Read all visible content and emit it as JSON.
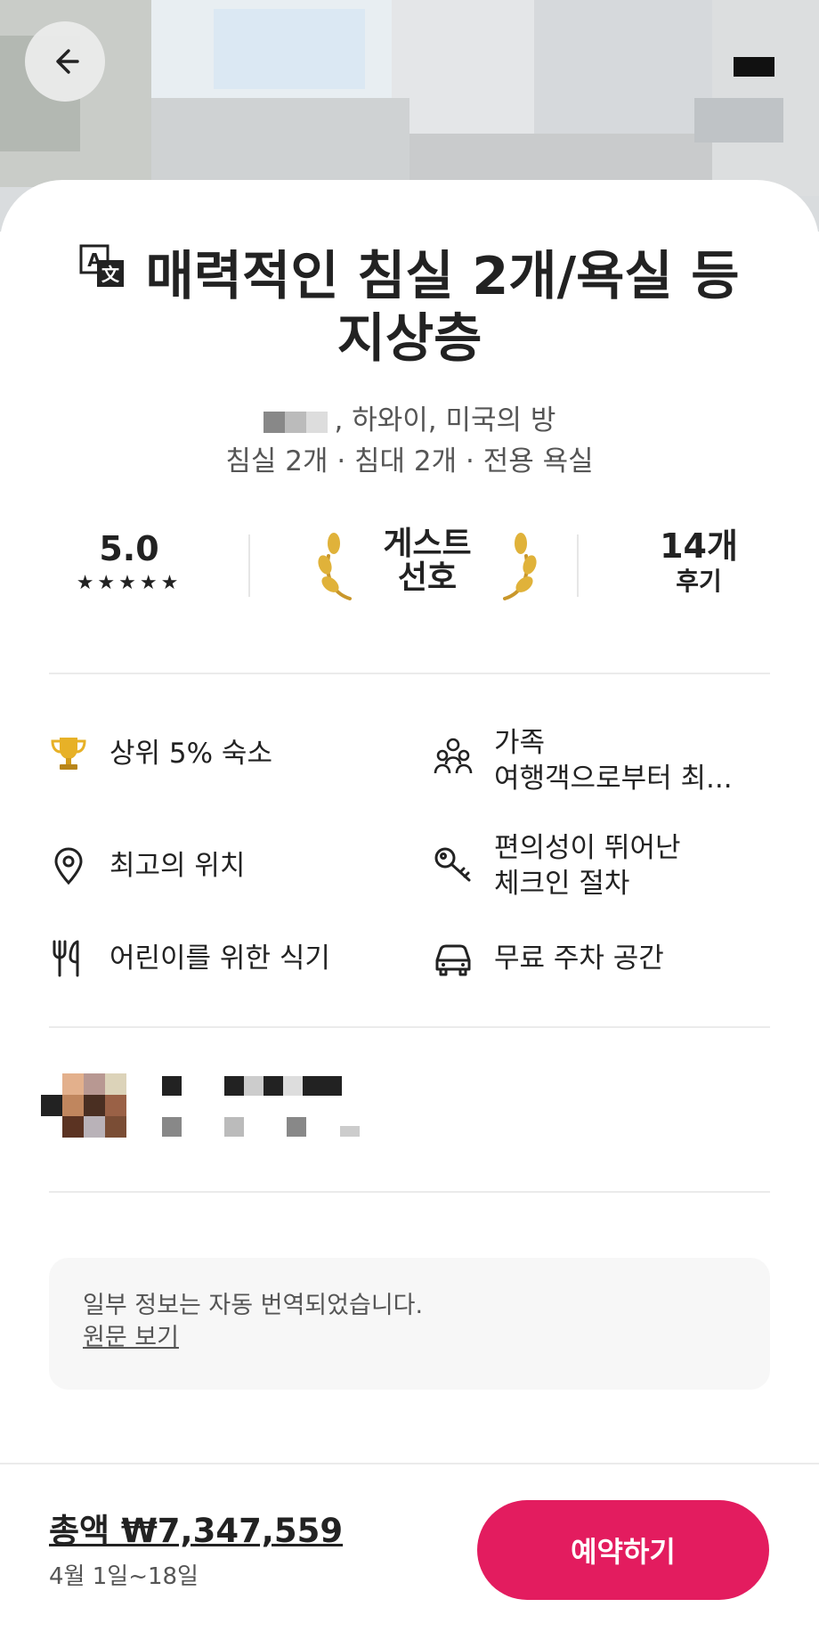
{
  "listing": {
    "title_line1": "매력적인 침실 2개/욕실 등",
    "title_line2": "지상층",
    "location_suffix": ", 하와이, 미국의 방",
    "details": "침실 2개 · 침대 2개 · 전용 욕실"
  },
  "stats": {
    "rating": "5.0",
    "stars": "★★★★★",
    "guest_favorite_line1": "게스트",
    "guest_favorite_line2": "선호",
    "review_count": "14개",
    "review_label": "후기"
  },
  "highlights": [
    {
      "icon": "trophy-icon",
      "label": "상위 5% 숙소"
    },
    {
      "icon": "family-icon",
      "label_line1": "가족",
      "label_line2": "여행객으로부터 최..."
    },
    {
      "icon": "location-pin-icon",
      "label": "최고의 위치"
    },
    {
      "icon": "key-icon",
      "label_line1": "편의성이 뛰어난",
      "label_line2": "체크인 절차"
    },
    {
      "icon": "utensils-icon",
      "label": "어린이를 위한 식기"
    },
    {
      "icon": "car-icon",
      "label": "무료 주차 공간"
    }
  ],
  "translation_notice": {
    "text": "일부 정보는 자동 번역되었습니다.",
    "link": "원문 보기"
  },
  "booking": {
    "total": "총액 ₩7,347,559",
    "dates": "4월 1일~18일",
    "reserve_label": "예약하기"
  },
  "colors": {
    "accent": "#e31c5f",
    "text": "#222222",
    "muted": "#555555"
  }
}
